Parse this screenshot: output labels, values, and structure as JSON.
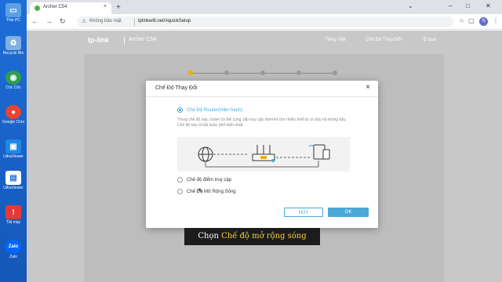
{
  "desktop": {
    "icons": [
      {
        "label": "This PC",
        "icon": "computer-icon",
        "color": "#5aa0e6"
      },
      {
        "label": "Recycle Bin",
        "icon": "recycle-bin-icon",
        "color": "#7fb0e0"
      },
      {
        "label": "Cốc Cốc",
        "icon": "coccoc-icon",
        "color": "#2e9e4f"
      },
      {
        "label": "Google Chrome",
        "icon": "chrome-icon",
        "color": "#ea4335"
      },
      {
        "label": "UltraViewer",
        "icon": "ultraviewer-icon",
        "color": "#1e88e5"
      },
      {
        "label": "UltraViewer",
        "icon": "document-icon",
        "color": "#ffffff"
      },
      {
        "label": "Tắt máy",
        "icon": "power-icon",
        "color": "#e53935"
      },
      {
        "label": "Zalo",
        "icon": "zalo-icon",
        "color": "#0068ff"
      }
    ]
  },
  "browser": {
    "tab_title": "Archer C54",
    "tab_close": "×",
    "new_tab": "+",
    "insecure_label": "Không bảo mật",
    "url": "tplinkwifi.net/#quickSetup",
    "profile_initial": "N"
  },
  "router": {
    "brand": "tp-link",
    "model": "Archer C54",
    "links": {
      "language": "Tiếng Việt",
      "mode": "Chế Độ Thay Đổi",
      "logout": "Đ qua"
    },
    "steps_total": 6,
    "active_step": 1
  },
  "modal": {
    "title": "Chế Độ Thay Đổi",
    "close": "×",
    "options": [
      {
        "label": "Chế Độ Router(Hiện hành)",
        "selected": true
      },
      {
        "label": "Chế độ điểm truy cập",
        "selected": false
      },
      {
        "label": "Chế Độ Mở Rộng Sóng",
        "selected": false
      }
    ],
    "description": "Trong chế độ này, router có thể cung cấp truy cập internet cho nhiều thiết bị có dây và không dây. Chế độ này là bắt buộc phổ biến nhất.",
    "cancel_label": "HỦY",
    "ok_label": "OK"
  },
  "caption": {
    "prefix": "Chọn ",
    "highlight": "Chế độ mở rộng sóng"
  },
  "colors": {
    "accent": "#4aa8d8",
    "step_active": "#f0b000",
    "caption_highlight": "#f4d03f"
  }
}
